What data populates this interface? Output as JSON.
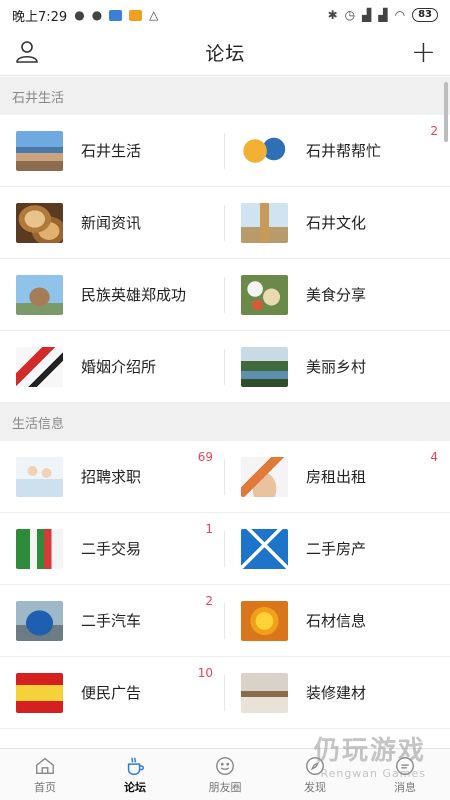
{
  "status_bar": {
    "time": "晚上7:29",
    "battery": "83"
  },
  "header": {
    "title": "论坛"
  },
  "sections": [
    {
      "title": "石井生活",
      "items": [
        {
          "label": "石井生活",
          "badge": "",
          "thumb": "coast-photo"
        },
        {
          "label": "石井帮帮忙",
          "badge": "2",
          "thumb": "fish-illustration"
        },
        {
          "label": "新闻资讯",
          "badge": "",
          "thumb": "bread-photo"
        },
        {
          "label": "石井文化",
          "badge": "",
          "thumb": "pagoda-photo"
        },
        {
          "label": "民族英雄郑成功",
          "badge": "",
          "thumb": "statue-photo"
        },
        {
          "label": "美食分享",
          "badge": "",
          "thumb": "food-photo"
        },
        {
          "label": "婚姻介绍所",
          "badge": "",
          "thumb": "calligraphy-image"
        },
        {
          "label": "美丽乡村",
          "badge": "",
          "thumb": "village-photo"
        }
      ]
    },
    {
      "title": "生活信息",
      "items": [
        {
          "label": "招聘求职",
          "badge": "69",
          "thumb": "office-photo"
        },
        {
          "label": "房租出租",
          "badge": "4",
          "thumb": "house-in-hand-photo"
        },
        {
          "label": "二手交易",
          "badge": "1",
          "thumb": "trade-graphic"
        },
        {
          "label": "二手房产",
          "badge": "",
          "thumb": "house-icon-tile"
        },
        {
          "label": "二手汽车",
          "badge": "2",
          "thumb": "car-photo"
        },
        {
          "label": "石材信息",
          "badge": "",
          "thumb": "yen-gold-graphic"
        },
        {
          "label": "便民广告",
          "badge": "10",
          "thumb": "ad-banner-graphic"
        },
        {
          "label": "装修建材",
          "badge": "",
          "thumb": "interior-photo"
        }
      ]
    }
  ],
  "bottom_nav": [
    {
      "label": "首页",
      "icon": "home-icon",
      "active": false
    },
    {
      "label": "论坛",
      "icon": "cup-icon",
      "active": true
    },
    {
      "label": "朋友圈",
      "icon": "smile-icon",
      "active": false
    },
    {
      "label": "发现",
      "icon": "compass-icon",
      "active": false
    },
    {
      "label": "消息",
      "icon": "message-icon",
      "active": false
    }
  ],
  "watermark": {
    "text": "仍玩游戏",
    "sub": "Rengwan Games"
  },
  "colors": {
    "badge": "#e8455a",
    "section_bg": "#f0f0f0"
  }
}
